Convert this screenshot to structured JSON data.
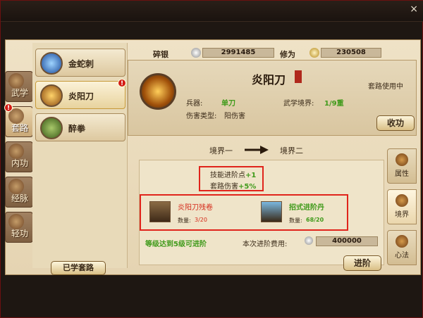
{
  "window": {
    "close_label": "×"
  },
  "resources": {
    "silver_label": "碎银",
    "silver_value": "2991485",
    "cultivation_label": "修为",
    "cultivation_value": "230508"
  },
  "left_tabs": [
    {
      "label": "武学"
    },
    {
      "label": "套路"
    },
    {
      "label": "内功"
    },
    {
      "label": "经脉"
    },
    {
      "label": "轻功"
    }
  ],
  "skills": [
    {
      "name": "金蛇刺"
    },
    {
      "name": "炎阳刀"
    },
    {
      "name": "醉拳"
    }
  ],
  "learned_button": "已学套路",
  "detail": {
    "title": "炎阳刀",
    "status": "套路使用中",
    "weapon_label": "兵器:",
    "weapon_value": "单刀",
    "realm_label": "武学境界:",
    "realm_value": "1/9重",
    "damage_label": "伤害类型:",
    "damage_value": "阳伤害",
    "collect_button": "收功"
  },
  "realm_path": {
    "from": "境界一",
    "to": "境界二"
  },
  "bonuses": {
    "skill_points_label": "技能进阶点",
    "skill_points_value": "+1",
    "damage_label": "套路伤害",
    "damage_value": "+5%"
  },
  "materials": [
    {
      "name": "炎阳刀残卷",
      "qty_label": "数量:",
      "qty_value": "3/20"
    },
    {
      "name": "招式进阶丹",
      "qty_label": "数量:",
      "qty_value": "68/20"
    }
  ],
  "requirement": "等级达到5级可进阶",
  "cost_label": "本次进阶费用:",
  "cost_value": "400000",
  "advance_button": "进阶",
  "right_tabs": [
    {
      "label": "属性"
    },
    {
      "label": "境界"
    },
    {
      "label": "心法"
    }
  ],
  "badge_mark": "!",
  "colors": {
    "accent_red": "#e0241b",
    "green": "#3f9a1a",
    "gold": "#c79a3a"
  }
}
